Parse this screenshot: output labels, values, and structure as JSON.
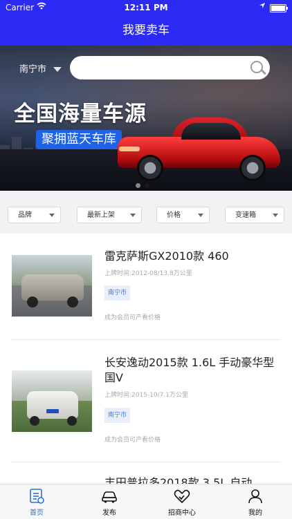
{
  "status_bar": {
    "carrier": "Carrier",
    "time": "12:11 PM"
  },
  "header": {
    "title": "我要卖车"
  },
  "banner": {
    "city": "南宁市",
    "search_placeholder": "",
    "headline": "全国海量车源",
    "tag": "聚拥蓝天车库",
    "page_count": 2,
    "active_page": 2
  },
  "filters": [
    {
      "label": "品牌"
    },
    {
      "label": "最新上架"
    },
    {
      "label": "价格"
    },
    {
      "label": "变速箱"
    }
  ],
  "listings": [
    {
      "title": "雷克萨斯GX2010款 460",
      "meta": "上牌时间:2012-08/13.8万公里",
      "city": "南宁市",
      "price_note": "成为会员可产看价格"
    },
    {
      "title": "长安逸动2015款 1.6L 手动豪华型 国V",
      "meta": "上牌时间:2015-10/7.1万公里",
      "city": "南宁市",
      "price_note": "成为会员可产看价格"
    },
    {
      "title": "丰田普拉多2018款 3.5L 自动",
      "meta": "",
      "city": "",
      "price_note": ""
    }
  ],
  "tabbar": {
    "items": [
      {
        "label": "首页",
        "icon": "home-list-icon",
        "active": true
      },
      {
        "label": "发布",
        "icon": "car-icon",
        "active": false
      },
      {
        "label": "招商中心",
        "icon": "handshake-heart-icon",
        "active": false
      },
      {
        "label": "我的",
        "icon": "person-icon",
        "active": false
      }
    ]
  },
  "colors": {
    "primary": "#2b2bf5",
    "active_tab": "#2b6fe0",
    "tag_blue": "#1e62e6"
  }
}
